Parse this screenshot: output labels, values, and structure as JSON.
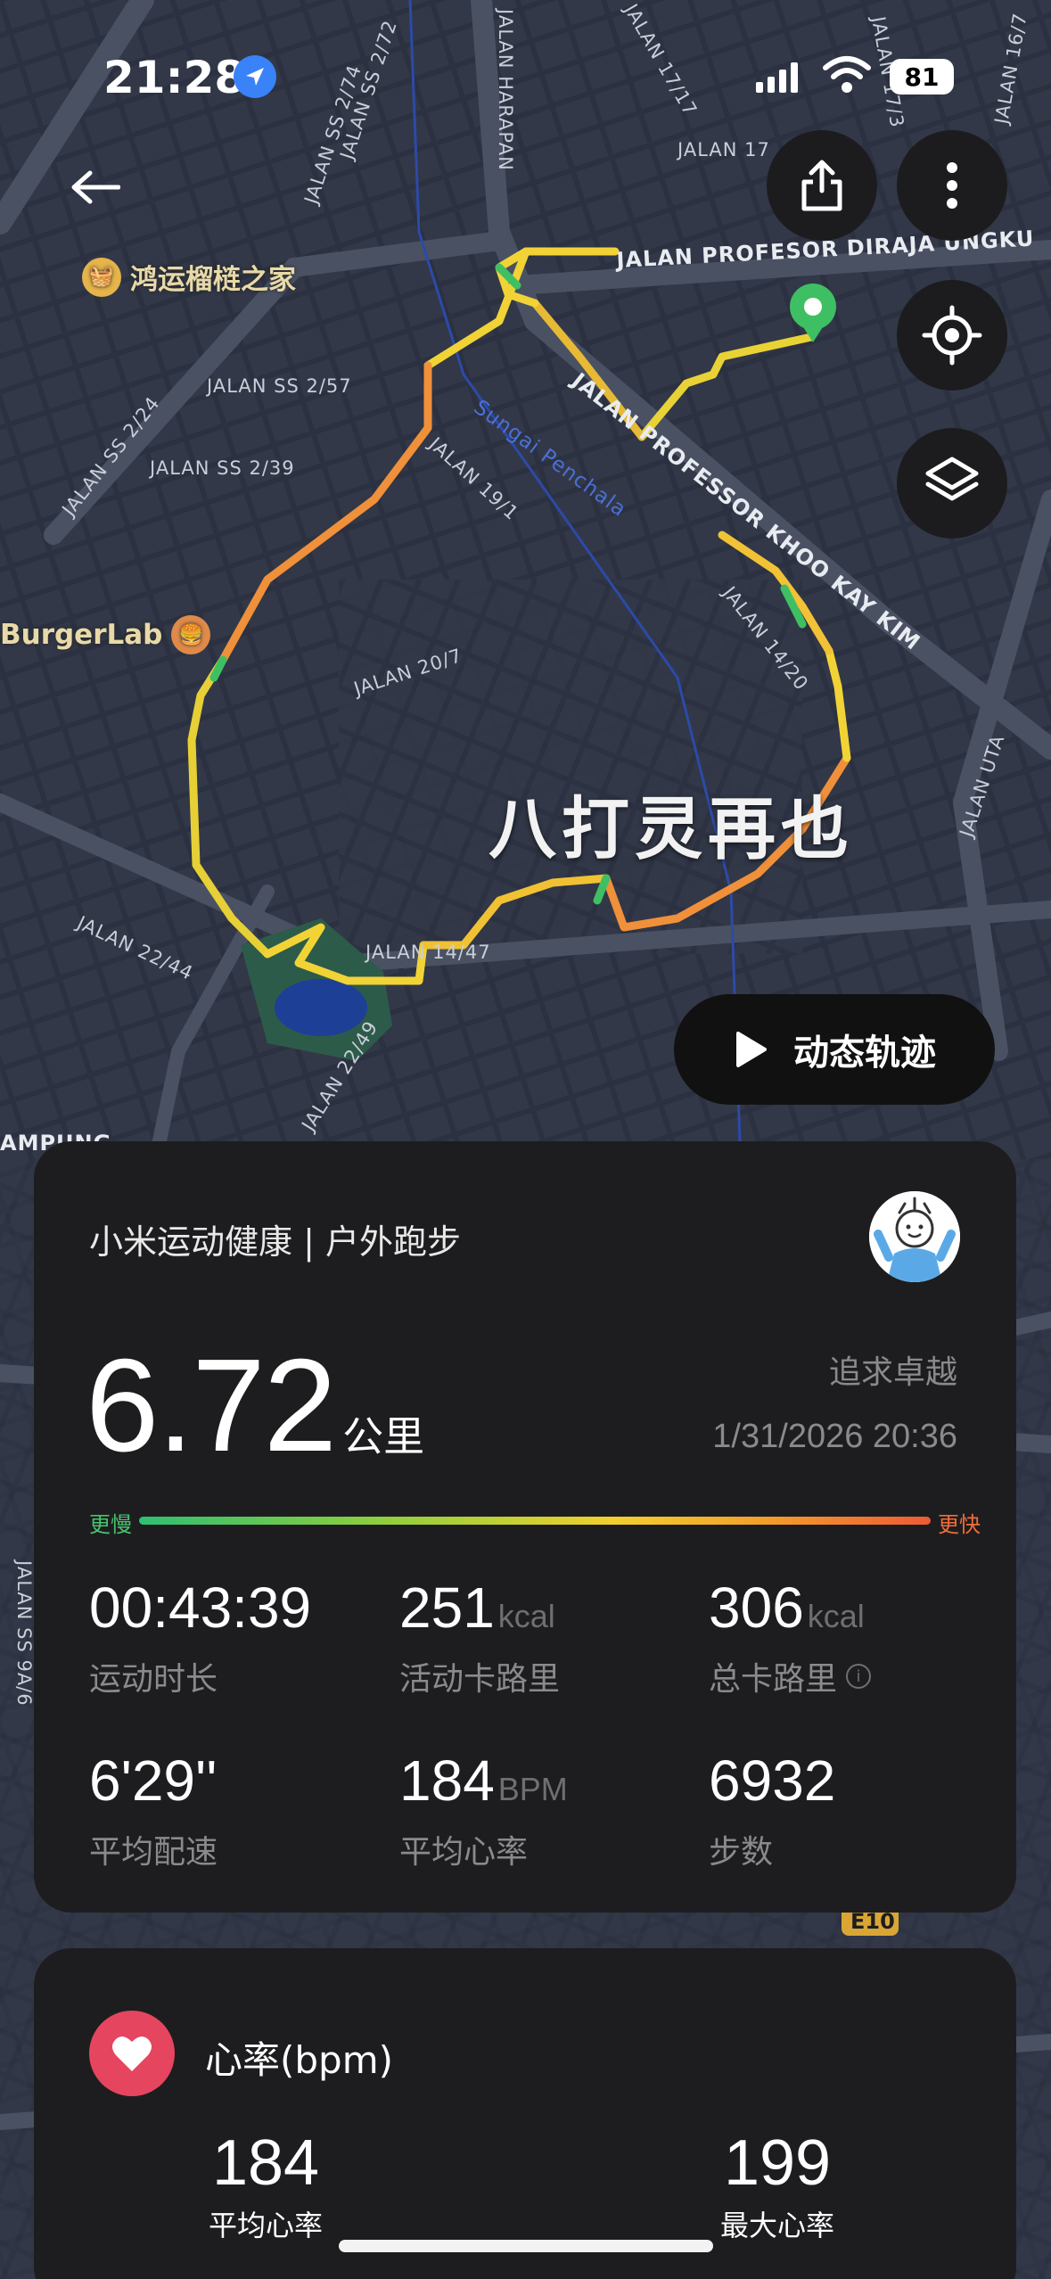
{
  "status_bar": {
    "time": "21:28",
    "battery": "81"
  },
  "map": {
    "streets": {
      "harapan": "JALAN HARAPAN",
      "profesor_diraja": "JALAN PROFESOR DIRAJA UNGKU",
      "professor_khoo": "JALAN PROFESSOR KHOO KAY KIM",
      "ss2_24": "JALAN SS 2/24",
      "ss2_57": "JALAN SS 2/57",
      "ss2_39": "JALAN SS 2/39",
      "ss2_74": "JALAN SS 2/74",
      "ss2_72": "JALAN SS 2/72",
      "j19_1": "JALAN 19/1",
      "j20_7": "JALAN 20/7",
      "j14_20": "JALAN 14/20",
      "j14_47": "JALAN 14/47",
      "j22_44": "JALAN 22/44",
      "j22_49": "JALAN 22/49",
      "j17_17": "JALAN 17/17",
      "j17_3": "JALAN 17/3",
      "j16_7": "JALAN 16/7",
      "j17": "JALAN 17",
      "utara": "JALAN UTA",
      "ss9a6": "JALAN SS 9A/6",
      "kampung": "AMPUNG",
      "e10": "E10"
    },
    "river": "Sungai Penchala",
    "poi_1": "鸿运榴梿之家",
    "poi_2": "BurgerLab",
    "district": "八打灵再也"
  },
  "controls": {
    "play_label": "动态轨迹"
  },
  "summary": {
    "app_title": "小米运动健康 | 户外跑步",
    "distance": "6.72",
    "distance_unit": "公里",
    "motto": "追求卓越",
    "datetime": "1/31/2026 20:36",
    "pace_slow": "更慢",
    "pace_fast": "更快",
    "metrics": [
      {
        "value": "00:43:39",
        "unit": "",
        "label": "运动时长"
      },
      {
        "value": "251",
        "unit": "kcal",
        "label": "活动卡路里"
      },
      {
        "value": "306",
        "unit": "kcal",
        "label": "总卡路里"
      },
      {
        "value": "6'29''",
        "unit": "",
        "label": "平均配速"
      },
      {
        "value": "184",
        "unit": "BPM",
        "label": "平均心率"
      },
      {
        "value": "6932",
        "unit": "",
        "label": "步数"
      }
    ]
  },
  "heart_rate": {
    "title": "心率(bpm)",
    "avg_value": "184",
    "avg_label": "平均心率",
    "max_value": "199",
    "max_label": "最大心率"
  },
  "colors": {
    "track_green": "#3fbf63",
    "track_yellow": "#f1d336",
    "track_orange": "#f0903a",
    "heart_red": "#e5455e",
    "card_bg": "#1d1d1f"
  }
}
